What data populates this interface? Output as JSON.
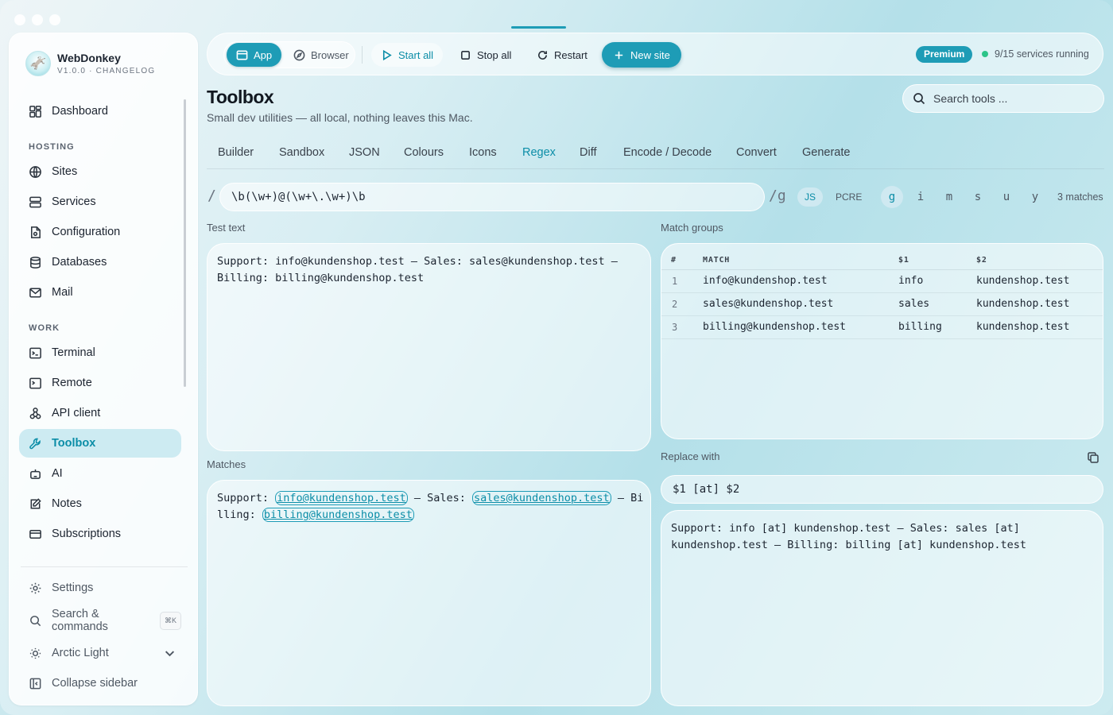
{
  "brand": {
    "name": "WebDonkey",
    "subtitle": "V1.0.0 · CHANGELOG",
    "logo": "donkey-logo-icon"
  },
  "sidebar": {
    "items": [
      {
        "label": "Dashboard",
        "icon": "dashboard-icon"
      },
      {
        "label": "Sites",
        "icon": "globe-icon"
      },
      {
        "label": "Services",
        "icon": "server-icon"
      },
      {
        "label": "Configuration",
        "icon": "config-file-icon"
      },
      {
        "label": "Databases",
        "icon": "database-icon"
      },
      {
        "label": "Mail",
        "icon": "mail-icon"
      },
      {
        "label": "Terminal",
        "icon": "terminal-icon"
      },
      {
        "label": "Remote",
        "icon": "remote-terminal-icon"
      },
      {
        "label": "API client",
        "icon": "api-icon"
      },
      {
        "label": "Toolbox",
        "icon": "wrench-icon"
      },
      {
        "label": "AI",
        "icon": "robot-icon"
      },
      {
        "label": "Notes",
        "icon": "notes-icon"
      },
      {
        "label": "Subscriptions",
        "icon": "card-icon"
      }
    ],
    "sections": {
      "hosting": "HOSTING",
      "work": "WORK"
    },
    "active": "Toolbox",
    "footer": {
      "settings": "Settings",
      "search": "Search & commands",
      "search_shortcut": "⌘K",
      "theme": "Arctic Light",
      "collapse": "Collapse sidebar"
    }
  },
  "toolbar": {
    "app": "App",
    "browser": "Browser",
    "start_all": "Start all",
    "stop_all": "Stop all",
    "restart": "Restart",
    "new_site": "New site",
    "badge": "Premium",
    "status": "9/15 services running"
  },
  "header": {
    "title": "Toolbox",
    "subtitle": "Small dev utilities — all local, nothing leaves this Mac.",
    "search_placeholder": "Search tools ..."
  },
  "tabs": [
    "Builder",
    "Sandbox",
    "JSON",
    "Colours",
    "Icons",
    "Regex",
    "Diff",
    "Encode / Decode",
    "Convert",
    "Generate"
  ],
  "active_tab": "Regex",
  "regex": {
    "open_slash": "/",
    "pattern": "\\b(\\w+)@(\\w+\\.\\w+)\\b",
    "suffix": "/g",
    "engines": [
      "JS",
      "PCRE"
    ],
    "active_engine": "JS",
    "flags": [
      "g",
      "i",
      "m",
      "s",
      "u",
      "y"
    ],
    "active_flags": [
      "g"
    ],
    "matches_count": "3 matches"
  },
  "test_text": {
    "label": "Test text",
    "value": "Support: info@kundenshop.test — Sales: sales@kundenshop.test — Billing: billing@kundenshop.test"
  },
  "match_groups": {
    "label": "Match groups",
    "columns": [
      "#",
      "MATCH",
      "$1",
      "$2"
    ],
    "rows": [
      [
        "1",
        "info@kundenshop.test",
        "info",
        "kundenshop.test"
      ],
      [
        "2",
        "sales@kundenshop.test",
        "sales",
        "kundenshop.test"
      ],
      [
        "3",
        "billing@kundenshop.test",
        "billing",
        "kundenshop.test"
      ]
    ]
  },
  "matches": {
    "label": "Matches",
    "segments": [
      {
        "text": "Support: ",
        "match": false
      },
      {
        "text": "info@kundenshop.test",
        "match": true
      },
      {
        "text": " — Sales: ",
        "match": false
      },
      {
        "text": "sales@kundenshop.test",
        "match": true
      },
      {
        "text": " — Billing: ",
        "match": false
      },
      {
        "text": "billing@kundenshop.test",
        "match": true
      }
    ]
  },
  "replace": {
    "label": "Replace with",
    "value": "$1 [at] $2",
    "result": "Support: info [at] kundenshop.test — Sales: sales [at] kundenshop.test — Billing: billing [at] kundenshop.test",
    "copy_icon": "copy-icon"
  },
  "colors": {
    "accent": "#1e9cb6",
    "accent_text": "#0b8da7",
    "status_ok": "#2cc489"
  }
}
